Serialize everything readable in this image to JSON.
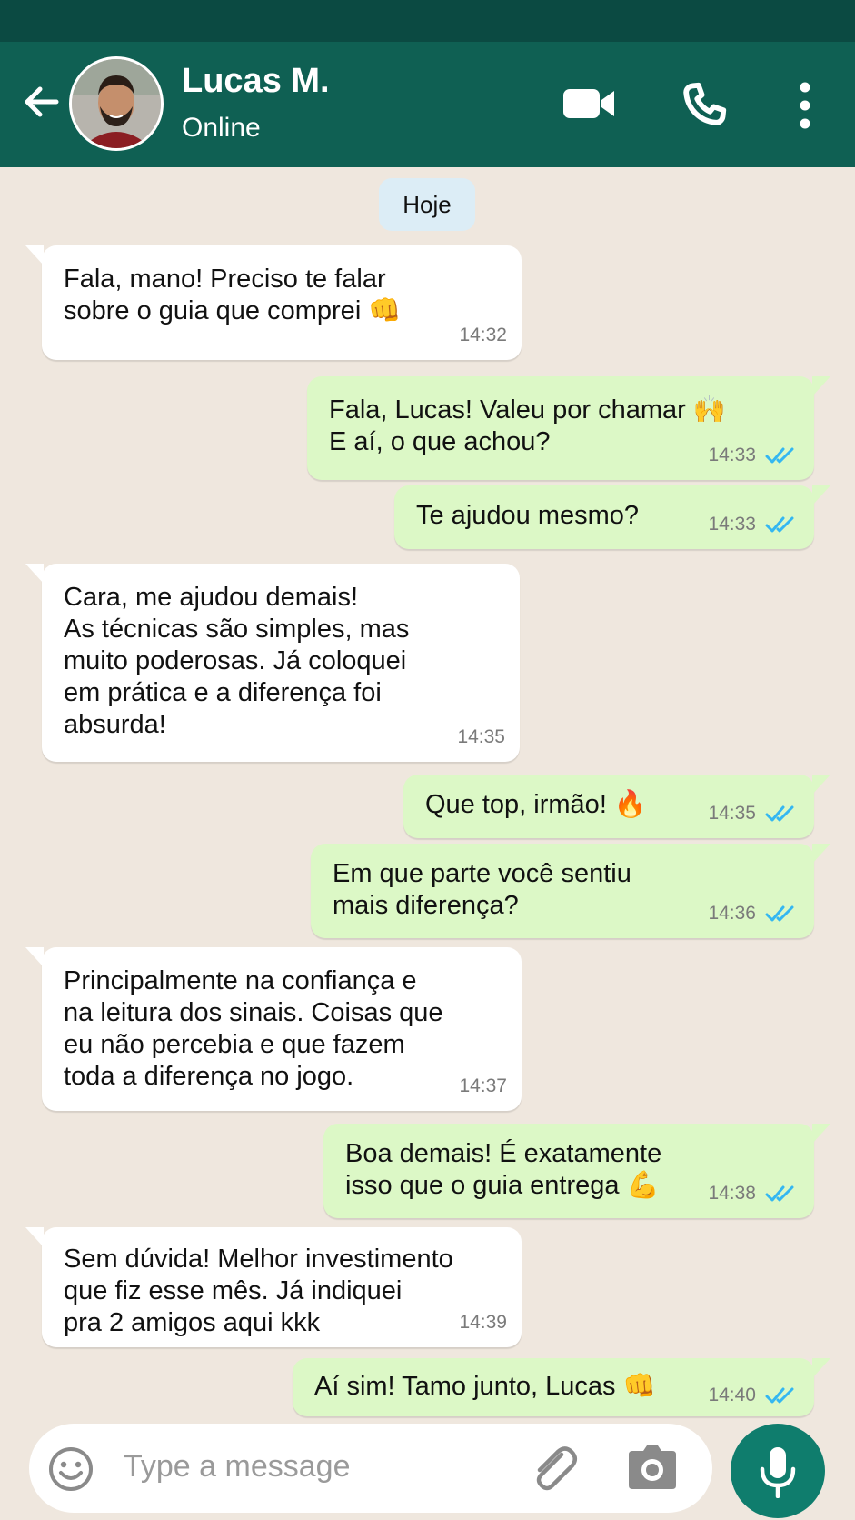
{
  "contact": {
    "name": "Lucas M.",
    "status": "Online"
  },
  "date_divider": "Hoje",
  "messages": [
    {
      "dir": "in",
      "text": "Fala, mano! Preciso te falar\nsobre o guia que comprei 👊",
      "time": "14:32"
    },
    {
      "dir": "out",
      "text": "Fala, Lucas! Valeu por chamar 🙌\nE aí, o que achou?",
      "time": "14:33",
      "read": true
    },
    {
      "dir": "out",
      "text": "Te ajudou mesmo?",
      "time": "14:33",
      "read": true
    },
    {
      "dir": "in",
      "text": "Cara, me ajudou demais!\nAs técnicas são simples, mas\nmuito poderosas. Já coloquei\nem prática e a diferença foi\nabsurda!",
      "time": "14:35"
    },
    {
      "dir": "out",
      "text": "Que top, irmão! 🔥",
      "time": "14:35",
      "read": true
    },
    {
      "dir": "out",
      "text": "Em que parte você sentiu\nmais diferença?",
      "time": "14:36",
      "read": true
    },
    {
      "dir": "in",
      "text": "Principalmente na confiança e\nna leitura dos sinais. Coisas que\neu não percebia e que fazem\ntoda a diferença no jogo.",
      "time": "14:37"
    },
    {
      "dir": "out",
      "text": "Boa demais! É exatamente\nisso que o guia entrega 💪",
      "time": "14:38",
      "read": true
    },
    {
      "dir": "in",
      "text": "Sem dúvida! Melhor investimento\nque fiz esse mês. Já indiquei\npra 2 amigos aqui kkk",
      "time": "14:39"
    },
    {
      "dir": "out",
      "text": "Aí sim! Tamo junto, Lucas 👊",
      "time": "14:40",
      "read": true
    }
  ],
  "composer": {
    "placeholder": "Type a message"
  },
  "icons": {
    "back": "arrow-left-icon",
    "video": "video-call-icon",
    "phone": "phone-icon",
    "menu": "more-vertical-icon",
    "emoji": "emoji-icon",
    "attach": "paperclip-icon",
    "camera": "camera-icon",
    "mic": "microphone-icon",
    "read_receipt": "double-check-icon"
  },
  "colors": {
    "header": "#0f6053",
    "status_bar": "#0b4a42",
    "chat_background": "#efe7de",
    "incoming_bubble": "#ffffff",
    "outgoing_bubble": "#dcf8c6",
    "read_check": "#34b7f1",
    "mic_button": "#0f7d6d"
  }
}
